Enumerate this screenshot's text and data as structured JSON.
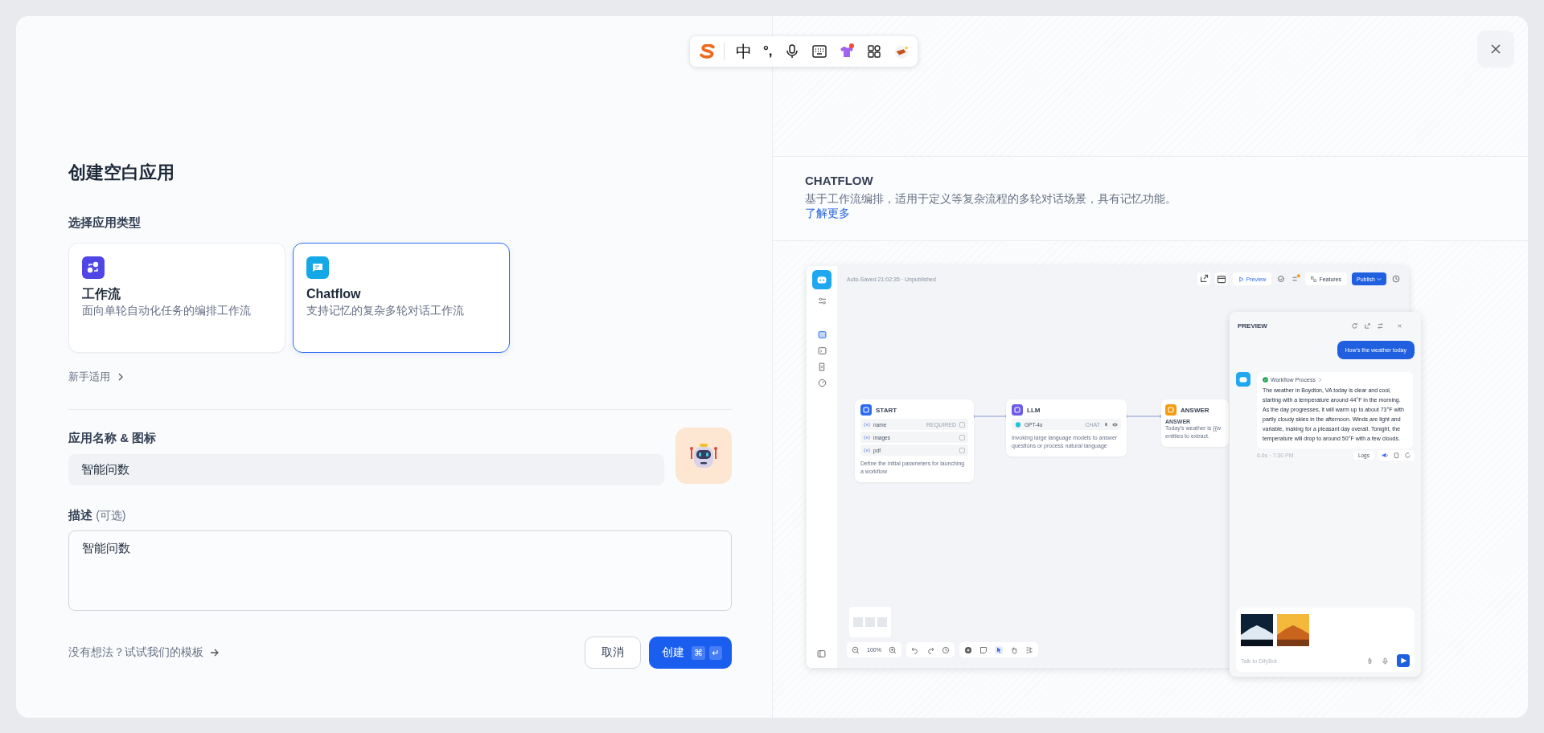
{
  "ime_toolbar": {
    "language": "中",
    "punctuation": "°,"
  },
  "dialog": {
    "title": "创建空白应用",
    "type_label": "选择应用类型",
    "app_types": [
      {
        "kind": "workflow",
        "name": "工作流",
        "description": "面向单轮自动化任务的编排工作流",
        "selected": false
      },
      {
        "kind": "chatflow",
        "name": "Chatflow",
        "description": "支持记忆的复杂多轮对话工作流",
        "selected": true
      }
    ],
    "beginner_link": "新手适用",
    "name_label": "应用名称 & 图标",
    "name_value": "智能问数",
    "description_label": "描述",
    "description_optional": "(可选)",
    "description_value": "智能问数",
    "template_link": "没有想法？试试我们的模板",
    "cancel": "取消",
    "create": "创建",
    "shortcut_keys": [
      "⌘",
      "↵"
    ]
  },
  "info": {
    "title": "CHATFLOW",
    "description": "基于工作流编排，适用于定义等复杂流程的多轮对话场景，具有记忆功能。",
    "link": "了解更多"
  },
  "screenshot": {
    "autosave": "Auto-Saved 21:02:35 · Unpublished",
    "preview": "Preview",
    "features": "Features",
    "publish": "Publish",
    "zoom": "100%",
    "nodes": [
      {
        "kind": "start",
        "title": "START",
        "variables": [
          {
            "name": "name",
            "tag": "REQUIRED"
          },
          {
            "name": "images"
          },
          {
            "name": "pdf"
          }
        ],
        "description": "Define the initial parameters for launching a workflow"
      },
      {
        "kind": "llm",
        "title": "LLM",
        "model": "GPT-4o",
        "model_tag": "CHAT",
        "description": "Invoking large language models to answer questions or process natural language"
      },
      {
        "kind": "answer",
        "title": "ANSWER",
        "field": "ANSWER",
        "lines": [
          "Today's weather is {{w",
          "entities to extract."
        ]
      }
    ],
    "chat": {
      "title": "PREVIEW",
      "user_message": "How's the weather today",
      "process_label": "Workflow Process",
      "reply": "The weather in Boydton, VA today is clear and cool, starting with a temperature around 44°F in the morning. As the day progresses, it will warm up to about 73°F with partly cloudy skies in the afternoon. Winds are light and variable, making for a pleasant day overall. Tonight, the temperature will drop to around 50°F with a few clouds.",
      "meta": "6.6s · 7:30 PM",
      "logs": "Logs",
      "placeholder": "Talk to DifyBot"
    }
  }
}
